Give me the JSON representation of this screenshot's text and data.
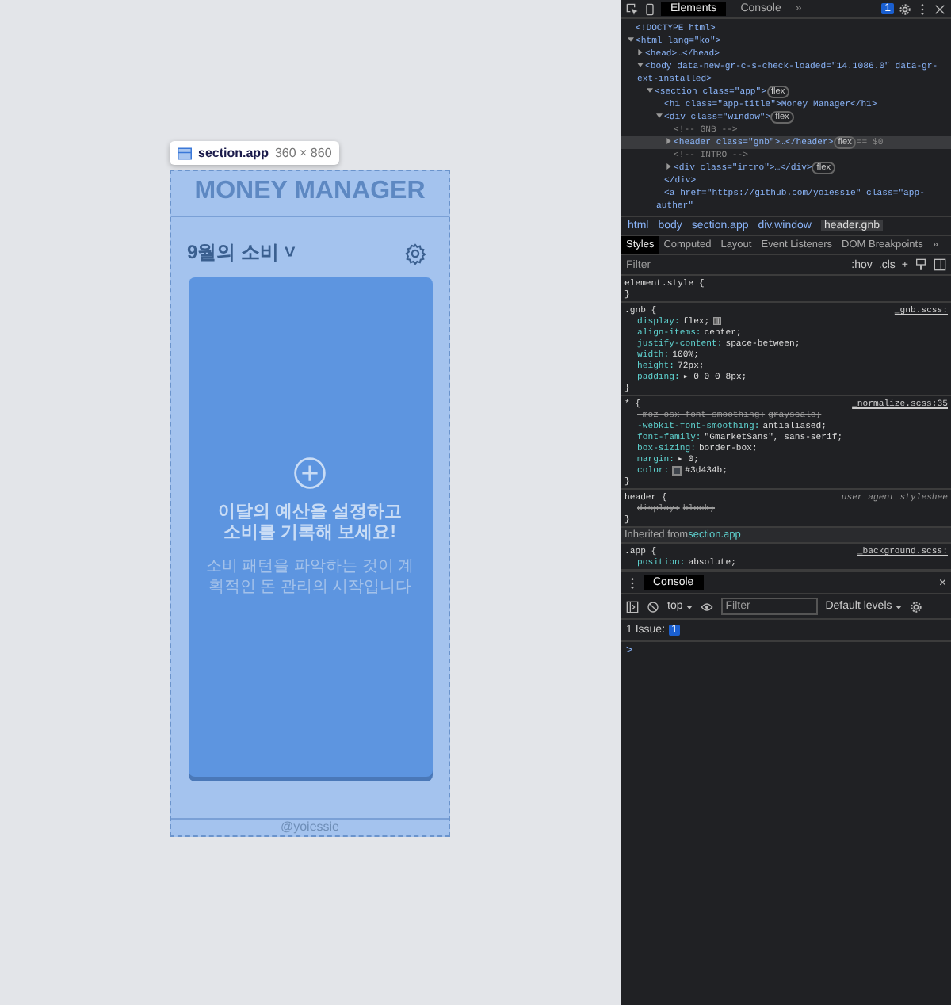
{
  "page": {
    "tooltip": {
      "selector": "section.app",
      "size": "360 × 860"
    },
    "app_title": "MONEY MANAGER",
    "header": {
      "title": "9월의 소비",
      "caret": "˅"
    },
    "card": {
      "heading": "이달의 예산을 설정하고 소비를 기록해 보세요!",
      "subtext": "소비 패턴을 파악하는 것이 계획적인 돈 관리의 시작입니다"
    },
    "footer": "@yoiessie"
  },
  "devtools": {
    "tabs": [
      {
        "label": "Elements",
        "selected": true
      },
      {
        "label": "Console",
        "selected": false
      }
    ],
    "more": "»",
    "issues_count": "1",
    "dom": [
      {
        "text": "<!DOCTYPE html>",
        "kind": "leaf",
        "selected": false
      },
      {
        "text": "<html lang=\"ko\">",
        "kind": "node",
        "expanded": true,
        "selected": false,
        "children": [
          {
            "text": "<head>…</head>",
            "kind": "node",
            "expanded": false,
            "selected": false
          },
          {
            "text": "<body data-new-gr-c-s-check-loaded=\"14.1086.0\" data-gr-ext-installed>",
            "kind": "node",
            "expanded": true,
            "selected": false,
            "children": [
              {
                "text": "<section class=\"app\">",
                "kind": "node",
                "expanded": true,
                "badge": "flex",
                "selected": false,
                "children": [
                  {
                    "text": "<h1 class=\"app-title\">Money Manager</h1>",
                    "kind": "leaf",
                    "selected": false
                  },
                  {
                    "text": "<div class=\"window\">",
                    "kind": "node",
                    "expanded": true,
                    "badge": "flex",
                    "selected": false,
                    "children": [
                      {
                        "text": "<!-- GNB -->",
                        "kind": "comment",
                        "selected": false
                      },
                      {
                        "text": "<header class=\"gnb\">…</header>",
                        "kind": "node",
                        "expanded": false,
                        "badge": "flex",
                        "suffix": "== $0",
                        "selected": true
                      },
                      {
                        "text": "<!-- INTRO -->",
                        "kind": "comment",
                        "selected": false
                      },
                      {
                        "text": "<div class=\"intro\">…</div>",
                        "kind": "node",
                        "expanded": false,
                        "badge": "flex",
                        "selected": false
                      }
                    ]
                  },
                  {
                    "text": "</div>",
                    "kind": "leaf",
                    "selected": false
                  },
                  {
                    "text": "<a href=\"https://github.com/yoiessie\" class=\"app-auther\"",
                    "kind": "leaf",
                    "selected": false
                  }
                ]
              }
            ]
          }
        ]
      }
    ],
    "breadcrumbs": [
      {
        "label": "html",
        "selected": false
      },
      {
        "label": "body",
        "selected": false
      },
      {
        "label": "section.app",
        "selected": false
      },
      {
        "label": "div.window",
        "selected": false
      },
      {
        "label": "header.gnb",
        "selected": true
      }
    ],
    "style_tabs": [
      {
        "label": "Styles",
        "selected": true
      },
      {
        "label": "Computed",
        "selected": false
      },
      {
        "label": "Layout",
        "selected": false
      },
      {
        "label": "Event Listeners",
        "selected": false
      },
      {
        "label": "DOM Breakpoints",
        "selected": false
      }
    ],
    "style_tabs_more": "»",
    "filter": {
      "placeholder": "Filter"
    },
    "hov": ":hov",
    "cls": ".cls",
    "add": "+",
    "rules": [
      {
        "kind": "rule",
        "selector": "element.style {",
        "close": "}"
      },
      {
        "kind": "rule",
        "selector": ".gnb {",
        "source": "_gnb.scss:",
        "italic": false,
        "close": "}",
        "decls": [
          {
            "prop": "display:",
            "value": "flex;",
            "struck": false,
            "flex_icon": true
          },
          {
            "prop": "align-items:",
            "value": "center;",
            "struck": false
          },
          {
            "prop": "justify-content:",
            "value": "space-between;",
            "struck": false
          },
          {
            "prop": "width:",
            "value": "100%;",
            "struck": false
          },
          {
            "prop": "height:",
            "value": "72px;",
            "struck": false
          },
          {
            "prop": "padding:",
            "value": "▸ 0 0 0 8px;",
            "struck": false
          }
        ]
      },
      {
        "kind": "rule",
        "selector": "* {",
        "source": "_normalize.scss:35",
        "italic": false,
        "close": "}",
        "decls": [
          {
            "prop": "-moz-osx-font-smoothing:",
            "value": "grayscale;",
            "struck": true
          },
          {
            "prop": "-webkit-font-smoothing:",
            "value": "antialiased;",
            "struck": false
          },
          {
            "prop": "font-family:",
            "value": "\"GmarketSans\", sans-serif;",
            "struck": false
          },
          {
            "prop": "box-sizing:",
            "value": "border-box;",
            "struck": false
          },
          {
            "prop": "margin:",
            "value": "▸ 0;",
            "struck": false
          },
          {
            "prop": "color:",
            "value": "#3d434b;",
            "struck": false,
            "swatch": true
          }
        ]
      },
      {
        "kind": "rule",
        "selector": "header {",
        "source": "user agent styleshee",
        "italic": true,
        "close": "}",
        "decls": [
          {
            "prop": "display:",
            "value": "block;",
            "struck": true
          }
        ]
      },
      {
        "kind": "inherited",
        "label": "Inherited from",
        "target": "section.app"
      },
      {
        "kind": "rule",
        "selector": ".app {",
        "source": "_background.scss:",
        "italic": false,
        "decls": [
          {
            "prop": "position:",
            "value": "absolute;",
            "struck": false
          }
        ]
      }
    ],
    "console": {
      "tab": "Console",
      "close": "×",
      "context": "top",
      "filter": {
        "placeholder": "Filter"
      },
      "levels": "Default levels",
      "issues_label": "1 Issue:",
      "issues_count": "1",
      "prompt": ">"
    }
  }
}
